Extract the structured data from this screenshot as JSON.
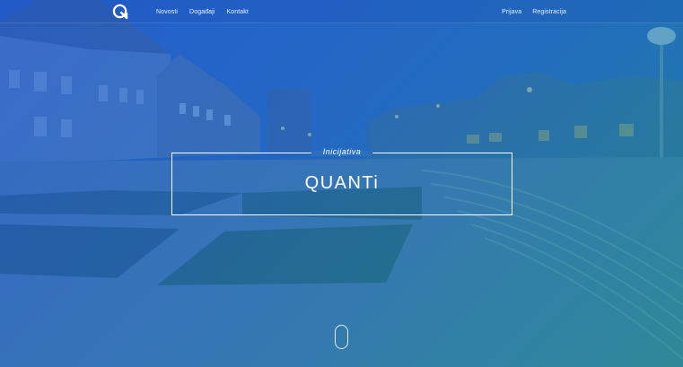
{
  "navbar": {
    "logo_icon": "quanti-q-logo",
    "left_links": [
      {
        "label": "Novosti"
      },
      {
        "label": "Događaji"
      },
      {
        "label": "Kontakt"
      }
    ],
    "right_links": [
      {
        "label": "Prijava"
      },
      {
        "label": "Registracija"
      }
    ]
  },
  "hero": {
    "kicker": "Inicijativa",
    "title": "QUANTi",
    "scroll_icon": "mouse-scroll-icon",
    "background_image": "town-square-at-dusk-photo"
  },
  "colors": {
    "gradient_start": "#1e5bd0",
    "gradient_end": "#179f78",
    "text": "#ffffff"
  }
}
